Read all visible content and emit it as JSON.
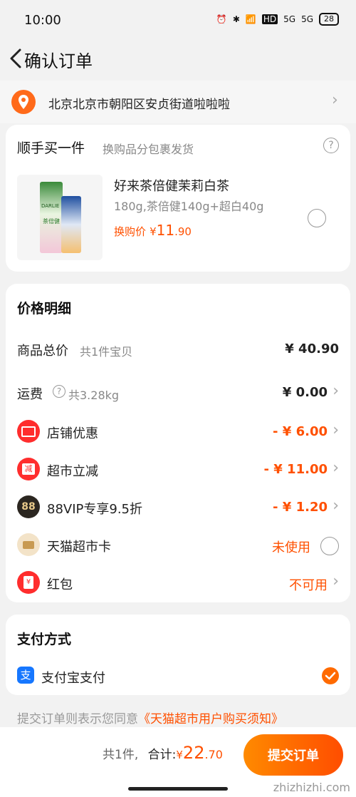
{
  "status_bar": {
    "time": "10:00",
    "network_1": "5G",
    "network_2": "5G",
    "hd": "HD",
    "battery": "28"
  },
  "header": {
    "title": "确认订单"
  },
  "address": {
    "text": "北京北京市朝阳区安贞街道啦啦啦"
  },
  "addon": {
    "title": "顺手买一件",
    "subtitle": "换购品分包裹发货",
    "product_name": "好来茶倍健茉莉白茶",
    "product_spec": "180g,茶倍健140g+超白40g",
    "price_label": "换购价",
    "currency": "¥",
    "price_int": "11",
    "price_dec": ".90",
    "product_image_text_1": "DARLIE",
    "product_image_text_2": "茶倍健"
  },
  "price_detail": {
    "title": "价格明细",
    "goods_total_label": "商品总价",
    "goods_total_note": "共1件宝贝",
    "goods_total_value": "¥ 40.90",
    "shipping_label": "运费",
    "shipping_note": "共3.28kg",
    "shipping_value": "¥ 0.00",
    "shop_discount_label": "店铺优惠",
    "shop_discount_value": "- ¥ 6.00",
    "market_discount_label": "超市立减",
    "market_discount_icon_text": "减",
    "market_discount_value": "- ¥ 11.00",
    "vip_label": "88VIP专享9.5折",
    "vip_icon_text": "88",
    "vip_value": "- ¥ 1.20",
    "card_label": "天猫超市卡",
    "card_value": "未使用",
    "redpacket_label": "红包",
    "redpacket_icon_text": "¥",
    "redpacket_value": "不可用"
  },
  "payment": {
    "title": "支付方式",
    "method_icon_text": "支",
    "method_label": "支付宝支付"
  },
  "agreement": {
    "text": "提交订单则表示您同意",
    "link": "《天猫超市用户购买须知》"
  },
  "bottom": {
    "count": "共1件,",
    "total_label": "合计:",
    "currency": "¥",
    "total_int": "22",
    "total_dec": ".70",
    "submit_label": "提交订单"
  },
  "watermark": "zhizhizhi.com",
  "colors": {
    "accent": "#ff5000",
    "background": "#f2f2f2",
    "card": "#ffffff"
  }
}
